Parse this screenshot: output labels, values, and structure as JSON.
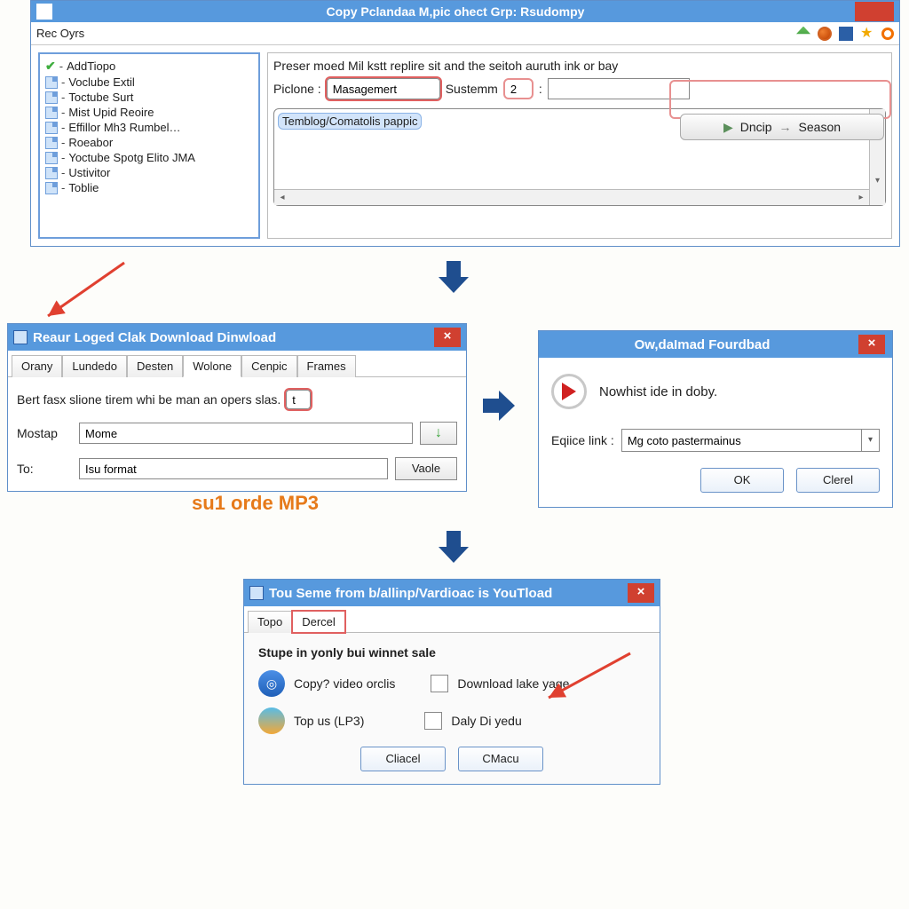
{
  "win1": {
    "title": "Copy Pclandaa M,pic ohect Grp: Rsudompy",
    "menu": "Rec Oyrs",
    "tree": [
      {
        "check": true,
        "label": "AddTiopo"
      },
      {
        "check": false,
        "label": "Voclube Extil"
      },
      {
        "check": false,
        "label": "Toctube Surt"
      },
      {
        "check": false,
        "label": "Mist Upid Reoire"
      },
      {
        "check": false,
        "label": "Effillor Mh3 Rumbel…"
      },
      {
        "check": false,
        "label": "Roeabor"
      },
      {
        "check": false,
        "label": "Yoctube Spotg Elito JMA"
      },
      {
        "check": false,
        "label": "Ustivitor"
      },
      {
        "check": false,
        "label": "Toblie"
      }
    ],
    "instruction": "Preser moed Mil kstt replire sit and the seitoh auruth ink or bay",
    "piclone_label": "Piclone :",
    "piclone_value": "Masagemert",
    "sustemm_label": "Sustemm",
    "sustemm_value": "2",
    "list_item": "Temblog/Comatolis pappic",
    "go_button_left": "Dncip",
    "go_button_right": "Season"
  },
  "win2": {
    "title": "Reaur Loged Clak  Download  Dinwload",
    "tabs": [
      "Orany",
      "Lundedo",
      "Desten",
      "Wolone",
      "Cenpic",
      "Frames"
    ],
    "active_tab_index": 3,
    "sentence": "Bert fasx slione tirem whi be man an opers slas.",
    "sentence_value": "t",
    "mostap_label": "Mostap",
    "mostap_value": "Mome",
    "to_label": "To:",
    "to_value": "Isu format",
    "vaole_btn": "Vaole"
  },
  "callout": "su1 orde MP3",
  "win3": {
    "title": "Ow,daImad Fourdbad",
    "message": "Nowhist ide in doby.",
    "equice_label": "Eqiice link :",
    "equice_value": "Mg coto pastermainus",
    "ok": "OK",
    "clerel": "Clerel"
  },
  "win4": {
    "title": "Tou Seme from b/allinp/Vardioac is YouTload",
    "tabs": [
      "Topo",
      "Dercel"
    ],
    "active_tab_index": 1,
    "heading": "Stupe in yonly bui winnet sale",
    "opt_copy": "Copy? video orclis",
    "opt_download": "Download lake yage",
    "opt_top": "Top us (LP3)",
    "opt_daly": "Daly Di yedu",
    "btn_cliacel": "Cliacel",
    "btn_cmacu": "CMacu"
  }
}
